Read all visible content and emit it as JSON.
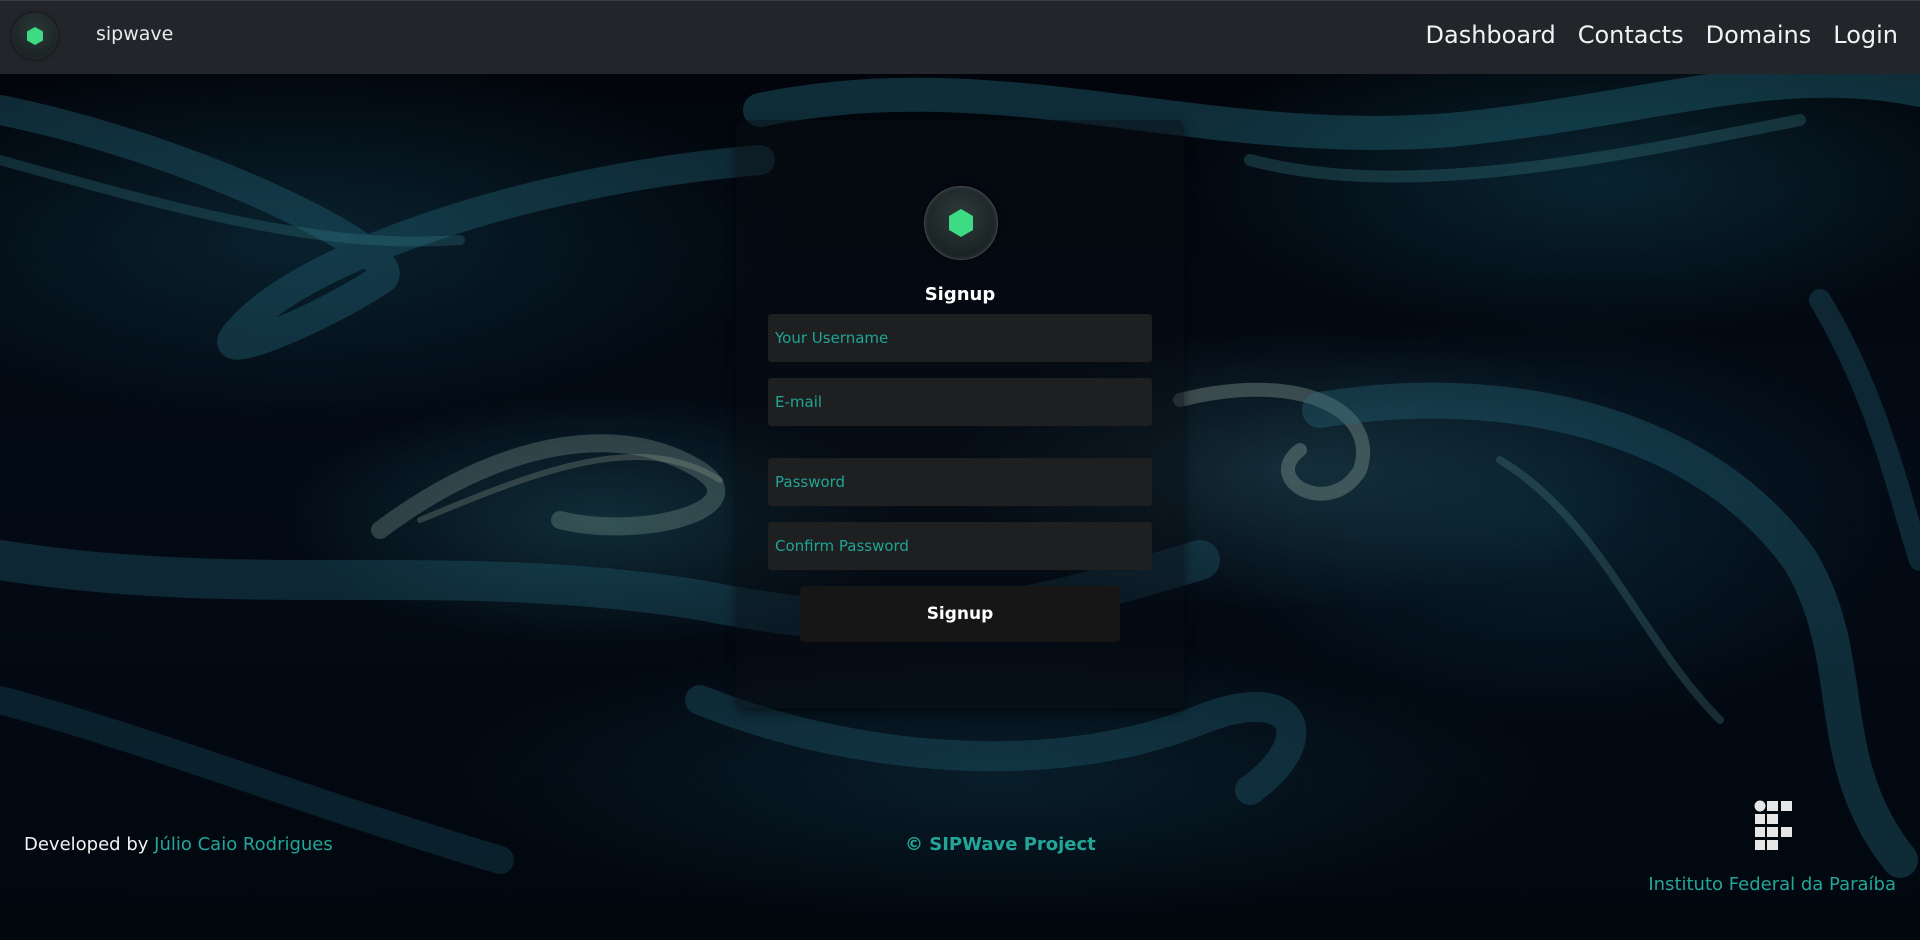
{
  "navbar": {
    "brand_name": "sipwave",
    "brand_icon": "hexagon-logo-icon",
    "links": [
      "Dashboard",
      "Contacts",
      "Domains",
      "Login"
    ]
  },
  "signup": {
    "logo_icon": "hexagon-logo-icon",
    "title": "Signup",
    "username_placeholder": "Your Username",
    "email_placeholder": "E-mail",
    "password_placeholder": "Password",
    "confirm_password_placeholder": "Confirm Password",
    "submit_label": "Signup"
  },
  "footer": {
    "developed_by_prefix": "Developed by",
    "developer_name": "Júlio Caio Rodrigues",
    "copyright": "© SIPWave Project",
    "institution_name": "Instituto Federal da Paraíba",
    "institution_logo_icon": "ifpb-logo-icon"
  },
  "colors": {
    "accent": "#22a69a",
    "logo_green": "#3ddc84",
    "navbar_bg": "#222529",
    "input_bg": "#1d1f20"
  }
}
